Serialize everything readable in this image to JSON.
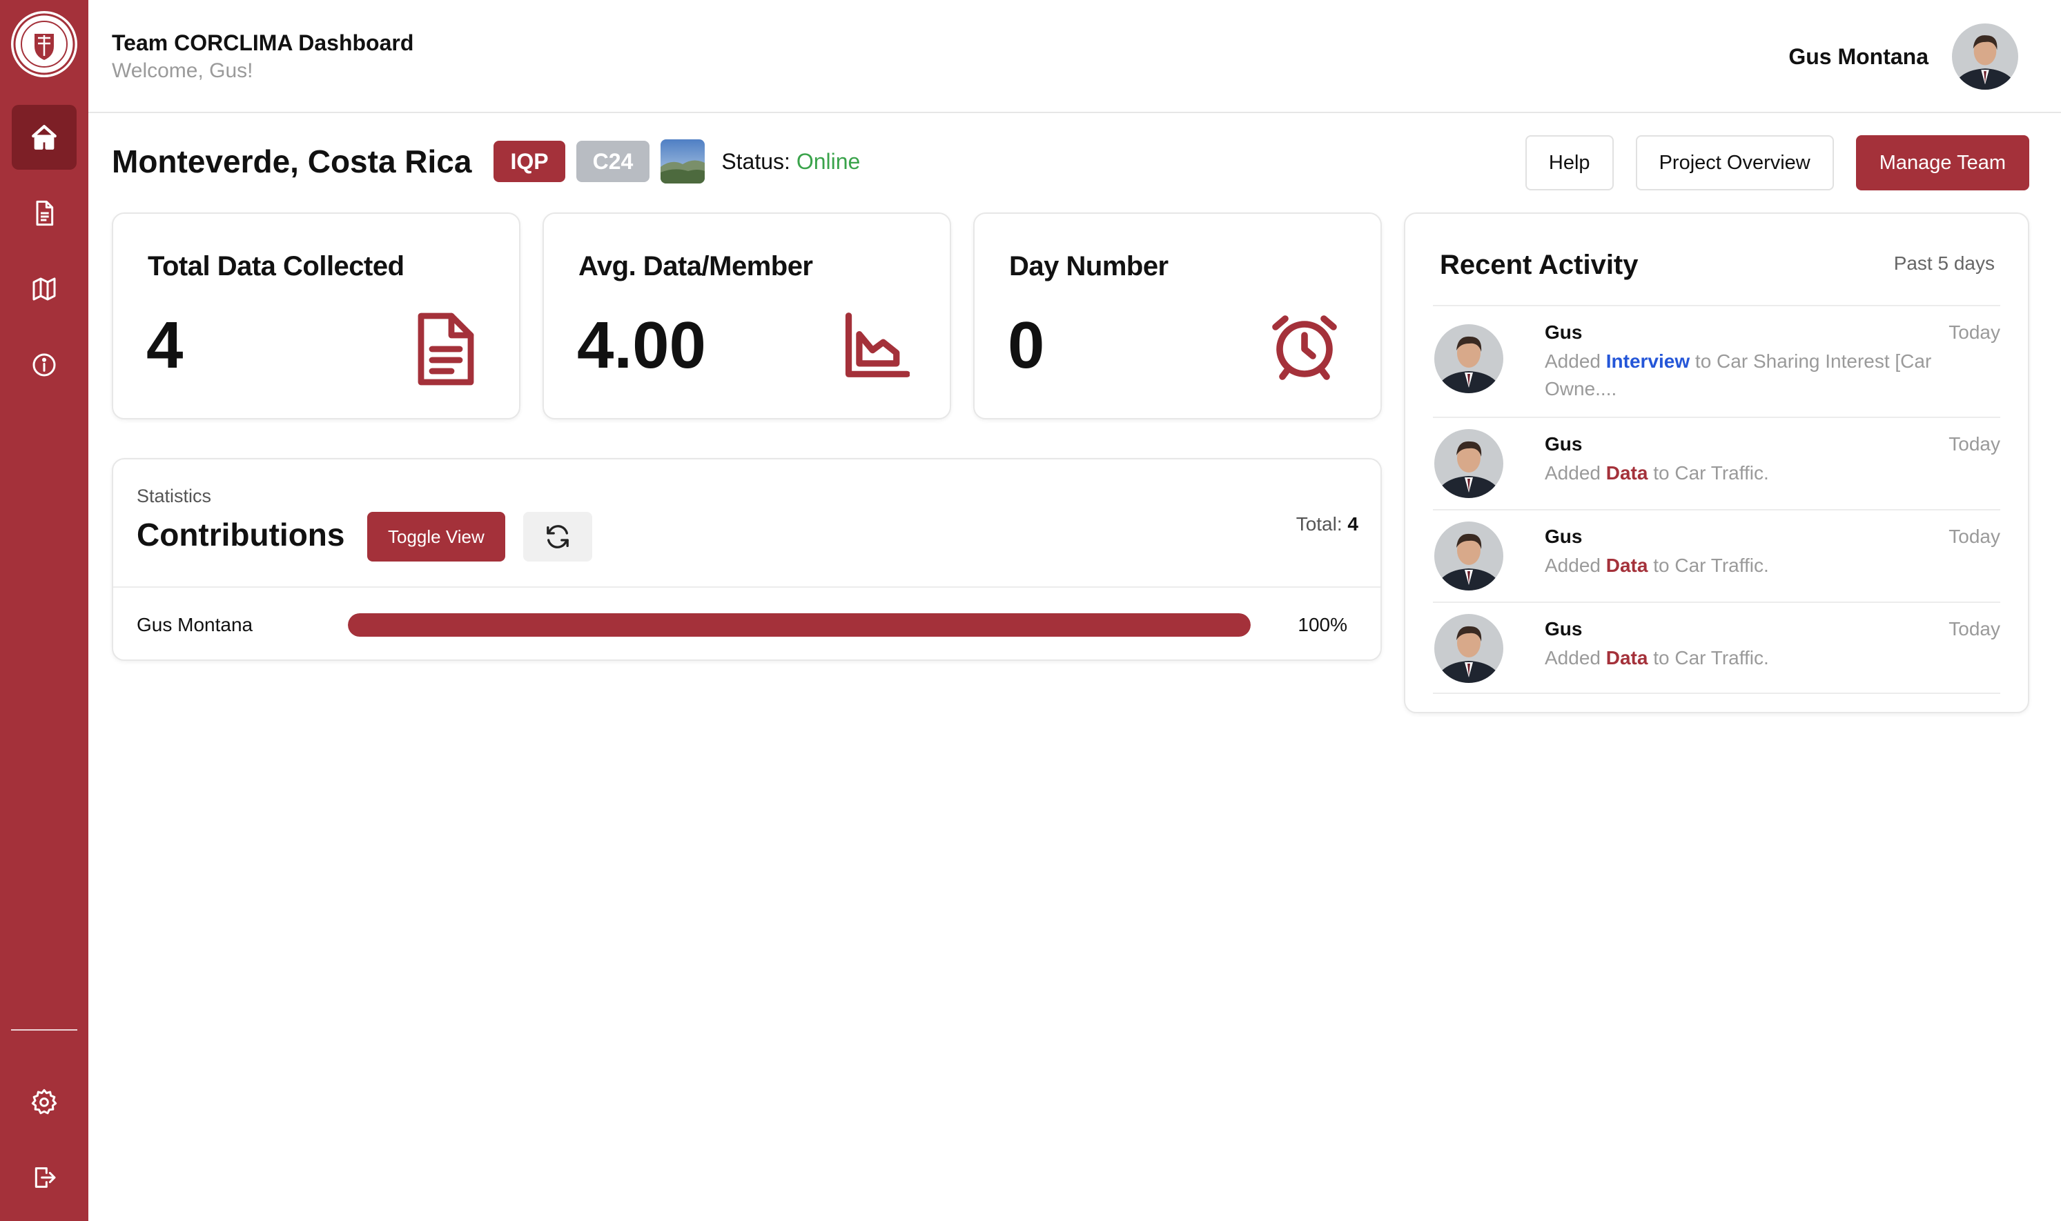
{
  "header": {
    "title": "Team CORCLIMA Dashboard",
    "subtitle": "Welcome, Gus!",
    "user_name": "Gus Montana"
  },
  "sidebar": {
    "items": [
      {
        "name": "home-icon",
        "active": true
      },
      {
        "name": "document-icon",
        "active": false
      },
      {
        "name": "map-icon",
        "active": false
      },
      {
        "name": "info-icon",
        "active": false
      }
    ],
    "bottom_items": [
      {
        "name": "gear-icon"
      },
      {
        "name": "logout-icon"
      }
    ]
  },
  "project": {
    "location": "Monteverde, Costa Rica",
    "badges": [
      "IQP",
      "C24"
    ],
    "status_label": "Status:",
    "status_value": "Online"
  },
  "actions": {
    "help": "Help",
    "overview": "Project Overview",
    "manage": "Manage Team"
  },
  "stats": [
    {
      "label": "Total Data Collected",
      "value": "4",
      "icon": "document-icon"
    },
    {
      "label": "Avg. Data/Member",
      "value": "4.00",
      "icon": "chart-icon"
    },
    {
      "label": "Day Number",
      "value": "0",
      "icon": "alarm-clock-icon"
    }
  ],
  "contributions": {
    "kicker": "Statistics",
    "title": "Contributions",
    "toggle_label": "Toggle View",
    "total_label": "Total:",
    "total_value": "4",
    "rows": [
      {
        "name": "Gus Montana",
        "percent": 100,
        "percent_label": "100%"
      }
    ]
  },
  "activity": {
    "title": "Recent Activity",
    "range": "Past 5 days",
    "items": [
      {
        "name": "Gus",
        "time": "Today",
        "prefix": "Added ",
        "keyword": "Interview",
        "keyword_color": "#2456d8",
        "suffix": " to Car Sharing Interest [Car Owne...."
      },
      {
        "name": "Gus",
        "time": "Today",
        "prefix": "Added ",
        "keyword": "Data",
        "keyword_color": "#a4313a",
        "suffix": " to Car Traffic."
      },
      {
        "name": "Gus",
        "time": "Today",
        "prefix": "Added ",
        "keyword": "Data",
        "keyword_color": "#a4313a",
        "suffix": " to Car Traffic."
      },
      {
        "name": "Gus",
        "time": "Today",
        "prefix": "Added ",
        "keyword": "Data",
        "keyword_color": "#a4313a",
        "suffix": " to Car Traffic."
      }
    ]
  },
  "colors": {
    "brand": "#a4313a",
    "brand_dark": "#7d1f26",
    "online": "#3aa34b",
    "link_blue": "#2456d8"
  }
}
